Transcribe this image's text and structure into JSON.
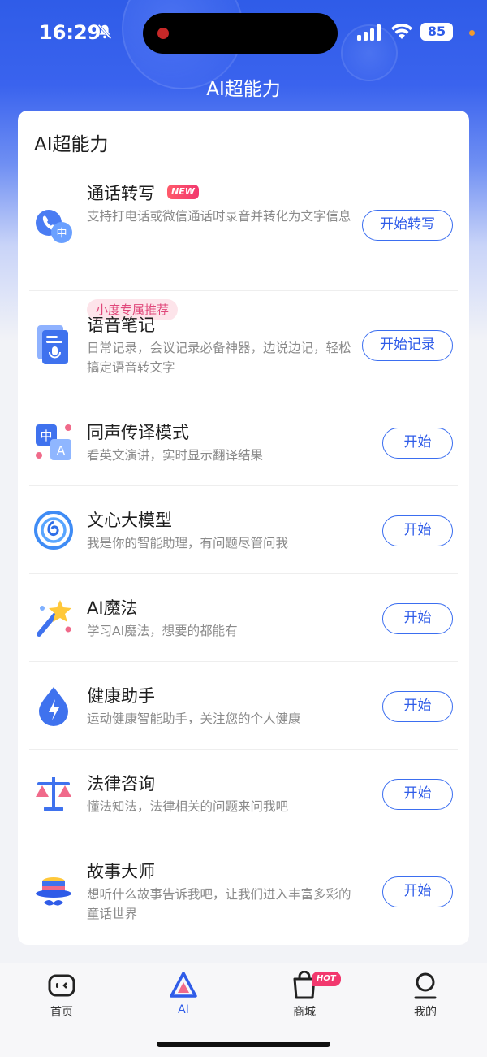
{
  "status_bar": {
    "time": "16:29",
    "battery": "85"
  },
  "header": {
    "title": "AI超能力"
  },
  "section": {
    "title": "AI超能力"
  },
  "items": [
    {
      "title": "通话转写",
      "badge": "NEW",
      "desc": "支持打电话或微信通话时录音并转化为文字信息",
      "tag": "小度专属推荐",
      "button": "开始转写",
      "icon": "call-transcribe-icon"
    },
    {
      "title": "语音笔记",
      "desc": "日常记录，会议记录必备神器，边说边记，轻松搞定语音转文字",
      "button": "开始记录",
      "icon": "voice-note-icon"
    },
    {
      "title": "同声传译模式",
      "desc": "看英文演讲，实时显示翻译结果",
      "button": "开始",
      "icon": "translate-icon"
    },
    {
      "title": "文心大模型",
      "desc": "我是你的智能助理，有问题尽管问我",
      "button": "开始",
      "icon": "ernie-icon"
    },
    {
      "title": "AI魔法",
      "desc": "学习AI魔法，想要的都能有",
      "button": "开始",
      "icon": "magic-wand-icon"
    },
    {
      "title": "健康助手",
      "desc": "运动健康智能助手，关注您的个人健康",
      "button": "开始",
      "icon": "health-drop-icon"
    },
    {
      "title": "法律咨询",
      "desc": "懂法知法，法律相关的问题来问我吧",
      "button": "开始",
      "icon": "scales-icon"
    },
    {
      "title": "故事大师",
      "desc": "想听什么故事告诉我吧，让我们进入丰富多彩的童话世界",
      "button": "开始",
      "icon": "magician-hat-icon"
    }
  ],
  "tabbar": {
    "tabs": [
      {
        "label": "首页",
        "icon": "home-robot-icon",
        "active": false
      },
      {
        "label": "AI",
        "icon": "ai-triangle-icon",
        "active": true
      },
      {
        "label": "商城",
        "icon": "shopping-bag-icon",
        "active": false,
        "badge": "HOT"
      },
      {
        "label": "我的",
        "icon": "profile-icon",
        "active": false
      }
    ]
  },
  "colors": {
    "accent": "#2f5ce8",
    "tag_pink": "#e0477a",
    "badge_red": "#f2386e"
  }
}
